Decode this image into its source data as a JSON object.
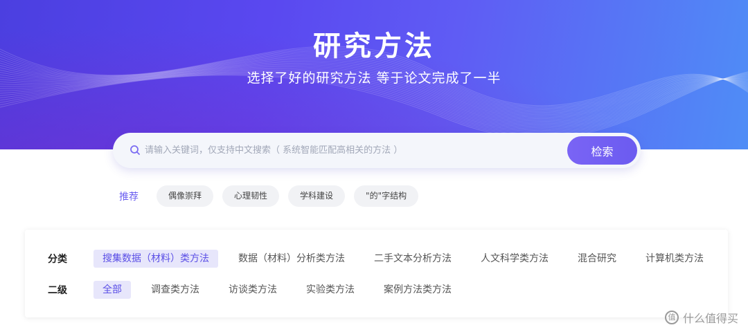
{
  "hero": {
    "title": "研究方法",
    "subtitle": "选择了好的研究方法 等于论文完成了一半"
  },
  "search": {
    "placeholder": "请输入关键词，仅支持中文搜索（ 系统智能匹配高相关的方法 ）",
    "value": "",
    "button_label": "检索",
    "icon": "search-icon"
  },
  "recommend": {
    "label": "推荐",
    "tags": [
      "偶像崇拜",
      "心理韧性",
      "学科建设",
      "\"的\"字结构"
    ]
  },
  "filters": {
    "category": {
      "label": "分类",
      "options": [
        "搜集数据（材料）类方法",
        "数据（材料）分析类方法",
        "二手文本分析方法",
        "人文科学类方法",
        "混合研究",
        "计算机类方法"
      ],
      "selected": "搜集数据（材料）类方法"
    },
    "subcategory": {
      "label": "二级",
      "options": [
        "全部",
        "调查类方法",
        "访谈类方法",
        "实验类方法",
        "案例方法类方法"
      ],
      "selected": "全部"
    }
  },
  "watermark": {
    "text": "什么值得买",
    "icon": "zhi-logo-icon",
    "icon_glyph": "值"
  },
  "colors": {
    "accent": "#6b5bf0",
    "active_bg": "#e7e6fb",
    "hero_start": "#4b3fe0",
    "hero_end": "#4f8df6"
  }
}
